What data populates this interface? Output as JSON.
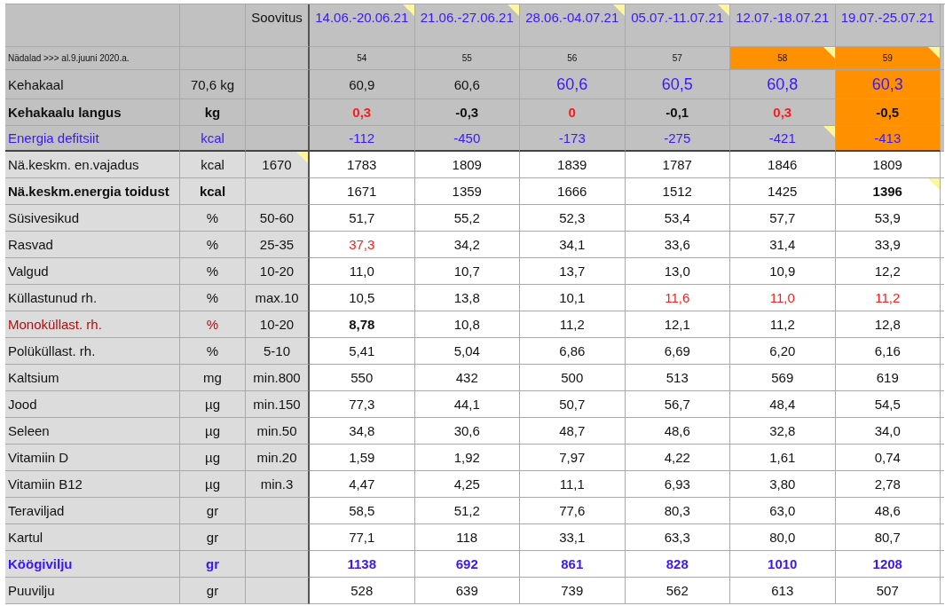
{
  "table": {
    "recommendation_header": "Soovitus",
    "weeks": [
      {
        "label": "14.06.-20.06.21",
        "note": true
      },
      {
        "label": "21.06.-27.06.21",
        "note": true
      },
      {
        "label": "28.06.-04.07.21",
        "note": true
      },
      {
        "label": "05.07.-11.07.21",
        "note": true
      },
      {
        "label": "12.07.-18.07.21",
        "note": false
      },
      {
        "label": "19.07.-25.07.21",
        "note": false
      }
    ],
    "week_numbers": {
      "label": "Nädalad >>> al.9.juuni 2020.a.",
      "numbers": [
        {
          "t": "54",
          "fill": false,
          "note": false
        },
        {
          "t": "55",
          "fill": false,
          "note": false
        },
        {
          "t": "56",
          "fill": false,
          "note": false
        },
        {
          "t": "57",
          "fill": false,
          "note": false
        },
        {
          "t": "58",
          "fill": true,
          "note": true
        },
        {
          "t": "59",
          "fill": true,
          "note": true
        }
      ]
    },
    "rows": [
      {
        "kind": "weight",
        "frozen": true,
        "label": "Kehakaal",
        "unit": "70,6 kg",
        "values": [
          {
            "t": "60,9",
            "alert": false,
            "accent": false,
            "bold": false,
            "fill": false,
            "note": false
          },
          {
            "t": "60,6",
            "alert": false,
            "accent": false,
            "bold": false,
            "fill": false,
            "note": false
          },
          {
            "t": "60,6",
            "alert": false,
            "accent": true,
            "bold": false,
            "fill": false,
            "note": false
          },
          {
            "t": "60,5",
            "alert": false,
            "accent": true,
            "bold": false,
            "fill": false,
            "note": false
          },
          {
            "t": "60,8",
            "alert": false,
            "accent": true,
            "bold": false,
            "fill": false,
            "note": false
          },
          {
            "t": "60,3",
            "alert": false,
            "accent": true,
            "bold": false,
            "fill": true,
            "note": false
          }
        ]
      },
      {
        "kind": "bold",
        "frozen": true,
        "label": "Kehakaalu langus",
        "unit": "kg",
        "values": [
          {
            "t": "0,3",
            "alert": true,
            "accent": false,
            "bold": true,
            "fill": false,
            "note": false
          },
          {
            "t": "-0,3",
            "alert": false,
            "accent": false,
            "bold": true,
            "fill": false,
            "note": false
          },
          {
            "t": "0",
            "alert": true,
            "accent": false,
            "bold": true,
            "fill": false,
            "note": false
          },
          {
            "t": "-0,1",
            "alert": false,
            "accent": false,
            "bold": true,
            "fill": false,
            "note": false
          },
          {
            "t": "0,3",
            "alert": true,
            "accent": false,
            "bold": true,
            "fill": false,
            "note": false
          },
          {
            "t": "-0,5",
            "alert": false,
            "accent": false,
            "bold": true,
            "fill": true,
            "note": false
          }
        ]
      },
      {
        "kind": "accent",
        "frozen": true,
        "label": "Energia defitsiit",
        "unit": "kcal",
        "values": [
          {
            "t": "-112",
            "alert": false,
            "accent": true,
            "bold": false,
            "fill": false,
            "note": false
          },
          {
            "t": "-450",
            "alert": false,
            "accent": true,
            "bold": false,
            "fill": false,
            "note": false
          },
          {
            "t": "-173",
            "alert": false,
            "accent": true,
            "bold": false,
            "fill": false,
            "note": false
          },
          {
            "t": "-275",
            "alert": false,
            "accent": true,
            "bold": false,
            "fill": false,
            "note": false
          },
          {
            "t": "-421",
            "alert": false,
            "accent": true,
            "bold": false,
            "fill": false,
            "note": true
          },
          {
            "t": "-413",
            "alert": false,
            "accent": true,
            "bold": false,
            "fill": true,
            "note": false
          }
        ]
      },
      {
        "kind": "plain",
        "frozen": false,
        "label": "Nä.keskm. en.vajadus",
        "unit": "kcal",
        "recommendation": {
          "t": "1670",
          "note": true
        },
        "values": [
          {
            "t": "1783",
            "alert": false,
            "accent": false,
            "bold": false,
            "fill": false,
            "note": false
          },
          {
            "t": "1809",
            "alert": false,
            "accent": false,
            "bold": false,
            "fill": false,
            "note": false
          },
          {
            "t": "1839",
            "alert": false,
            "accent": false,
            "bold": false,
            "fill": false,
            "note": false
          },
          {
            "t": "1787",
            "alert": false,
            "accent": false,
            "bold": false,
            "fill": false,
            "note": false
          },
          {
            "t": "1846",
            "alert": false,
            "accent": false,
            "bold": false,
            "fill": false,
            "note": false
          },
          {
            "t": "1809",
            "alert": false,
            "accent": false,
            "bold": false,
            "fill": false,
            "note": false
          }
        ]
      },
      {
        "kind": "bold",
        "frozen": false,
        "label": "Nä.keskm.energia toidust",
        "unit": "kcal",
        "values": [
          {
            "t": "1671",
            "alert": false,
            "accent": false,
            "bold": false,
            "fill": false,
            "note": false
          },
          {
            "t": "1359",
            "alert": false,
            "accent": false,
            "bold": false,
            "fill": false,
            "note": false
          },
          {
            "t": "1666",
            "alert": false,
            "accent": false,
            "bold": false,
            "fill": false,
            "note": false
          },
          {
            "t": "1512",
            "alert": false,
            "accent": false,
            "bold": false,
            "fill": false,
            "note": false
          },
          {
            "t": "1425",
            "alert": false,
            "accent": false,
            "bold": false,
            "fill": false,
            "note": false
          },
          {
            "t": "1396",
            "alert": false,
            "accent": false,
            "bold": true,
            "fill": false,
            "note": true
          }
        ]
      },
      {
        "kind": "plain",
        "frozen": false,
        "label": "Süsivesikud",
        "unit": "%",
        "recommendation": {
          "t": "50-60",
          "note": false
        },
        "values": [
          {
            "t": "51,7",
            "alert": false,
            "accent": false,
            "bold": false,
            "fill": false,
            "note": false
          },
          {
            "t": "55,2",
            "alert": false,
            "accent": false,
            "bold": false,
            "fill": false,
            "note": false
          },
          {
            "t": "52,3",
            "alert": false,
            "accent": false,
            "bold": false,
            "fill": false,
            "note": false
          },
          {
            "t": "53,4",
            "alert": false,
            "accent": false,
            "bold": false,
            "fill": false,
            "note": false
          },
          {
            "t": "57,7",
            "alert": false,
            "accent": false,
            "bold": false,
            "fill": false,
            "note": false
          },
          {
            "t": "53,9",
            "alert": false,
            "accent": false,
            "bold": false,
            "fill": false,
            "note": false
          }
        ]
      },
      {
        "kind": "plain",
        "frozen": false,
        "label": "Rasvad",
        "unit": "%",
        "recommendation": {
          "t": "25-35",
          "note": false
        },
        "values": [
          {
            "t": "37,3",
            "alert": true,
            "accent": false,
            "bold": false,
            "fill": false,
            "note": false
          },
          {
            "t": "34,2",
            "alert": false,
            "accent": false,
            "bold": false,
            "fill": false,
            "note": false
          },
          {
            "t": "34,1",
            "alert": false,
            "accent": false,
            "bold": false,
            "fill": false,
            "note": false
          },
          {
            "t": "33,6",
            "alert": false,
            "accent": false,
            "bold": false,
            "fill": false,
            "note": false
          },
          {
            "t": "31,4",
            "alert": false,
            "accent": false,
            "bold": false,
            "fill": false,
            "note": false
          },
          {
            "t": "33,9",
            "alert": false,
            "accent": false,
            "bold": false,
            "fill": false,
            "note": false
          }
        ]
      },
      {
        "kind": "plain",
        "frozen": false,
        "label": "Valgud",
        "unit": "%",
        "recommendation": {
          "t": "10-20",
          "note": false
        },
        "values": [
          {
            "t": "11,0",
            "alert": false,
            "accent": false,
            "bold": false,
            "fill": false,
            "note": false
          },
          {
            "t": "10,7",
            "alert": false,
            "accent": false,
            "bold": false,
            "fill": false,
            "note": false
          },
          {
            "t": "13,7",
            "alert": false,
            "accent": false,
            "bold": false,
            "fill": false,
            "note": false
          },
          {
            "t": "13,0",
            "alert": false,
            "accent": false,
            "bold": false,
            "fill": false,
            "note": false
          },
          {
            "t": "10,9",
            "alert": false,
            "accent": false,
            "bold": false,
            "fill": false,
            "note": false
          },
          {
            "t": "12,2",
            "alert": false,
            "accent": false,
            "bold": false,
            "fill": false,
            "note": false
          }
        ]
      },
      {
        "kind": "plain",
        "frozen": false,
        "label": "Küllastunud rh.",
        "unit": "%",
        "recommendation": {
          "t": "max.10",
          "note": false
        },
        "values": [
          {
            "t": "10,5",
            "alert": false,
            "accent": false,
            "bold": false,
            "fill": false,
            "note": false
          },
          {
            "t": "13,8",
            "alert": false,
            "accent": false,
            "bold": false,
            "fill": false,
            "note": false
          },
          {
            "t": "10,1",
            "alert": false,
            "accent": false,
            "bold": false,
            "fill": false,
            "note": false
          },
          {
            "t": "11,6",
            "alert": true,
            "accent": false,
            "bold": false,
            "fill": false,
            "note": false
          },
          {
            "t": "11,0",
            "alert": true,
            "accent": false,
            "bold": false,
            "fill": false,
            "note": false
          },
          {
            "t": "11,2",
            "alert": true,
            "accent": false,
            "bold": false,
            "fill": false,
            "note": false
          }
        ]
      },
      {
        "kind": "warning",
        "frozen": false,
        "label": "Monoküllast. rh.",
        "unit": "%",
        "recommendation": {
          "t": "10-20",
          "note": false
        },
        "values": [
          {
            "t": "8,78",
            "alert": false,
            "accent": false,
            "bold": true,
            "fill": false,
            "note": false
          },
          {
            "t": "10,8",
            "alert": false,
            "accent": false,
            "bold": false,
            "fill": false,
            "note": false
          },
          {
            "t": "11,2",
            "alert": false,
            "accent": false,
            "bold": false,
            "fill": false,
            "note": false
          },
          {
            "t": "12,1",
            "alert": false,
            "accent": false,
            "bold": false,
            "fill": false,
            "note": false
          },
          {
            "t": "11,2",
            "alert": false,
            "accent": false,
            "bold": false,
            "fill": false,
            "note": false
          },
          {
            "t": "12,8",
            "alert": false,
            "accent": false,
            "bold": false,
            "fill": false,
            "note": false
          }
        ]
      },
      {
        "kind": "plain",
        "frozen": false,
        "label": "Polüküllast. rh.",
        "unit": "%",
        "recommendation": {
          "t": "5-10",
          "note": false
        },
        "values": [
          {
            "t": "5,41",
            "alert": false,
            "accent": false,
            "bold": false,
            "fill": false,
            "note": false
          },
          {
            "t": "5,04",
            "alert": false,
            "accent": false,
            "bold": false,
            "fill": false,
            "note": false
          },
          {
            "t": "6,86",
            "alert": false,
            "accent": false,
            "bold": false,
            "fill": false,
            "note": false
          },
          {
            "t": "6,69",
            "alert": false,
            "accent": false,
            "bold": false,
            "fill": false,
            "note": false
          },
          {
            "t": "6,20",
            "alert": false,
            "accent": false,
            "bold": false,
            "fill": false,
            "note": false
          },
          {
            "t": "6,16",
            "alert": false,
            "accent": false,
            "bold": false,
            "fill": false,
            "note": false
          }
        ]
      },
      {
        "kind": "plain",
        "frozen": false,
        "label": "Kaltsium",
        "unit": "mg",
        "recommendation": {
          "t": "min.800",
          "note": false
        },
        "values": [
          {
            "t": "550",
            "alert": false,
            "accent": false,
            "bold": false,
            "fill": false,
            "note": false
          },
          {
            "t": "432",
            "alert": false,
            "accent": false,
            "bold": false,
            "fill": false,
            "note": false
          },
          {
            "t": "500",
            "alert": false,
            "accent": false,
            "bold": false,
            "fill": false,
            "note": false
          },
          {
            "t": "513",
            "alert": false,
            "accent": false,
            "bold": false,
            "fill": false,
            "note": false
          },
          {
            "t": "569",
            "alert": false,
            "accent": false,
            "bold": false,
            "fill": false,
            "note": false
          },
          {
            "t": "619",
            "alert": false,
            "accent": false,
            "bold": false,
            "fill": false,
            "note": false
          }
        ]
      },
      {
        "kind": "plain",
        "frozen": false,
        "label": "Jood",
        "unit": "µg",
        "recommendation": {
          "t": "min.150",
          "note": false
        },
        "values": [
          {
            "t": "77,3",
            "alert": false,
            "accent": false,
            "bold": false,
            "fill": false,
            "note": false
          },
          {
            "t": "44,1",
            "alert": false,
            "accent": false,
            "bold": false,
            "fill": false,
            "note": false
          },
          {
            "t": "50,7",
            "alert": false,
            "accent": false,
            "bold": false,
            "fill": false,
            "note": false
          },
          {
            "t": "56,7",
            "alert": false,
            "accent": false,
            "bold": false,
            "fill": false,
            "note": false
          },
          {
            "t": "48,4",
            "alert": false,
            "accent": false,
            "bold": false,
            "fill": false,
            "note": false
          },
          {
            "t": "54,5",
            "alert": false,
            "accent": false,
            "bold": false,
            "fill": false,
            "note": false
          }
        ]
      },
      {
        "kind": "plain",
        "frozen": false,
        "label": "Seleen",
        "unit": "µg",
        "recommendation": {
          "t": "min.50",
          "note": false
        },
        "values": [
          {
            "t": "34,8",
            "alert": false,
            "accent": false,
            "bold": false,
            "fill": false,
            "note": false
          },
          {
            "t": "30,6",
            "alert": false,
            "accent": false,
            "bold": false,
            "fill": false,
            "note": false
          },
          {
            "t": "48,7",
            "alert": false,
            "accent": false,
            "bold": false,
            "fill": false,
            "note": false
          },
          {
            "t": "48,6",
            "alert": false,
            "accent": false,
            "bold": false,
            "fill": false,
            "note": false
          },
          {
            "t": "32,8",
            "alert": false,
            "accent": false,
            "bold": false,
            "fill": false,
            "note": false
          },
          {
            "t": "34,0",
            "alert": false,
            "accent": false,
            "bold": false,
            "fill": false,
            "note": false
          }
        ]
      },
      {
        "kind": "plain",
        "frozen": false,
        "label": "Vitamiin D",
        "unit": "µg",
        "recommendation": {
          "t": "min.20",
          "note": false
        },
        "values": [
          {
            "t": "1,59",
            "alert": false,
            "accent": false,
            "bold": false,
            "fill": false,
            "note": false
          },
          {
            "t": "1,92",
            "alert": false,
            "accent": false,
            "bold": false,
            "fill": false,
            "note": false
          },
          {
            "t": "7,97",
            "alert": false,
            "accent": false,
            "bold": false,
            "fill": false,
            "note": false
          },
          {
            "t": "4,22",
            "alert": false,
            "accent": false,
            "bold": false,
            "fill": false,
            "note": false
          },
          {
            "t": "1,61",
            "alert": false,
            "accent": false,
            "bold": false,
            "fill": false,
            "note": false
          },
          {
            "t": "0,74",
            "alert": false,
            "accent": false,
            "bold": false,
            "fill": false,
            "note": false
          }
        ]
      },
      {
        "kind": "plain",
        "frozen": false,
        "label": "Vitamiin B12",
        "unit": "µg",
        "recommendation": {
          "t": "min.3",
          "note": false
        },
        "values": [
          {
            "t": "4,47",
            "alert": false,
            "accent": false,
            "bold": false,
            "fill": false,
            "note": false
          },
          {
            "t": "4,25",
            "alert": false,
            "accent": false,
            "bold": false,
            "fill": false,
            "note": false
          },
          {
            "t": "11,1",
            "alert": false,
            "accent": false,
            "bold": false,
            "fill": false,
            "note": false
          },
          {
            "t": "6,93",
            "alert": false,
            "accent": false,
            "bold": false,
            "fill": false,
            "note": false
          },
          {
            "t": "3,80",
            "alert": false,
            "accent": false,
            "bold": false,
            "fill": false,
            "note": false
          },
          {
            "t": "2,78",
            "alert": false,
            "accent": false,
            "bold": false,
            "fill": false,
            "note": false
          }
        ]
      },
      {
        "kind": "plain",
        "frozen": false,
        "label": "Teraviljad",
        "unit": "gr",
        "values": [
          {
            "t": "58,5",
            "alert": false,
            "accent": false,
            "bold": false,
            "fill": false,
            "note": false
          },
          {
            "t": "51,2",
            "alert": false,
            "accent": false,
            "bold": false,
            "fill": false,
            "note": false
          },
          {
            "t": "77,6",
            "alert": false,
            "accent": false,
            "bold": false,
            "fill": false,
            "note": false
          },
          {
            "t": "80,3",
            "alert": false,
            "accent": false,
            "bold": false,
            "fill": false,
            "note": false
          },
          {
            "t": "63,0",
            "alert": false,
            "accent": false,
            "bold": false,
            "fill": false,
            "note": false
          },
          {
            "t": "48,6",
            "alert": false,
            "accent": false,
            "bold": false,
            "fill": false,
            "note": false
          }
        ]
      },
      {
        "kind": "plain",
        "frozen": false,
        "label": "Kartul",
        "unit": "gr",
        "values": [
          {
            "t": "77,1",
            "alert": false,
            "accent": false,
            "bold": false,
            "fill": false,
            "note": false
          },
          {
            "t": "118",
            "alert": false,
            "accent": false,
            "bold": false,
            "fill": false,
            "note": false
          },
          {
            "t": "33,1",
            "alert": false,
            "accent": false,
            "bold": false,
            "fill": false,
            "note": false
          },
          {
            "t": "63,3",
            "alert": false,
            "accent": false,
            "bold": false,
            "fill": false,
            "note": false
          },
          {
            "t": "80,0",
            "alert": false,
            "accent": false,
            "bold": false,
            "fill": false,
            "note": false
          },
          {
            "t": "80,7",
            "alert": false,
            "accent": false,
            "bold": false,
            "fill": false,
            "note": false
          }
        ]
      },
      {
        "kind": "accent-bold",
        "frozen": false,
        "label": "Köögivilju",
        "unit": "gr",
        "values": [
          {
            "t": "1138",
            "alert": false,
            "accent": true,
            "bold": true,
            "fill": false,
            "note": false
          },
          {
            "t": "692",
            "alert": false,
            "accent": true,
            "bold": true,
            "fill": false,
            "note": false
          },
          {
            "t": "861",
            "alert": false,
            "accent": true,
            "bold": true,
            "fill": false,
            "note": false
          },
          {
            "t": "828",
            "alert": false,
            "accent": true,
            "bold": true,
            "fill": false,
            "note": false
          },
          {
            "t": "1010",
            "alert": false,
            "accent": true,
            "bold": true,
            "fill": false,
            "note": false
          },
          {
            "t": "1208",
            "alert": false,
            "accent": true,
            "bold": true,
            "fill": false,
            "note": false
          }
        ]
      },
      {
        "kind": "plain",
        "frozen": false,
        "label": "Puuvilju",
        "unit": "gr",
        "values": [
          {
            "t": "528",
            "alert": false,
            "accent": false,
            "bold": false,
            "fill": false,
            "note": false
          },
          {
            "t": "639",
            "alert": false,
            "accent": false,
            "bold": false,
            "fill": false,
            "note": false
          },
          {
            "t": "739",
            "alert": false,
            "accent": false,
            "bold": false,
            "fill": false,
            "note": false
          },
          {
            "t": "562",
            "alert": false,
            "accent": false,
            "bold": false,
            "fill": false,
            "note": false
          },
          {
            "t": "613",
            "alert": false,
            "accent": false,
            "bold": false,
            "fill": false,
            "note": false
          },
          {
            "t": "507",
            "alert": false,
            "accent": false,
            "bold": false,
            "fill": false,
            "note": false
          }
        ]
      }
    ]
  }
}
